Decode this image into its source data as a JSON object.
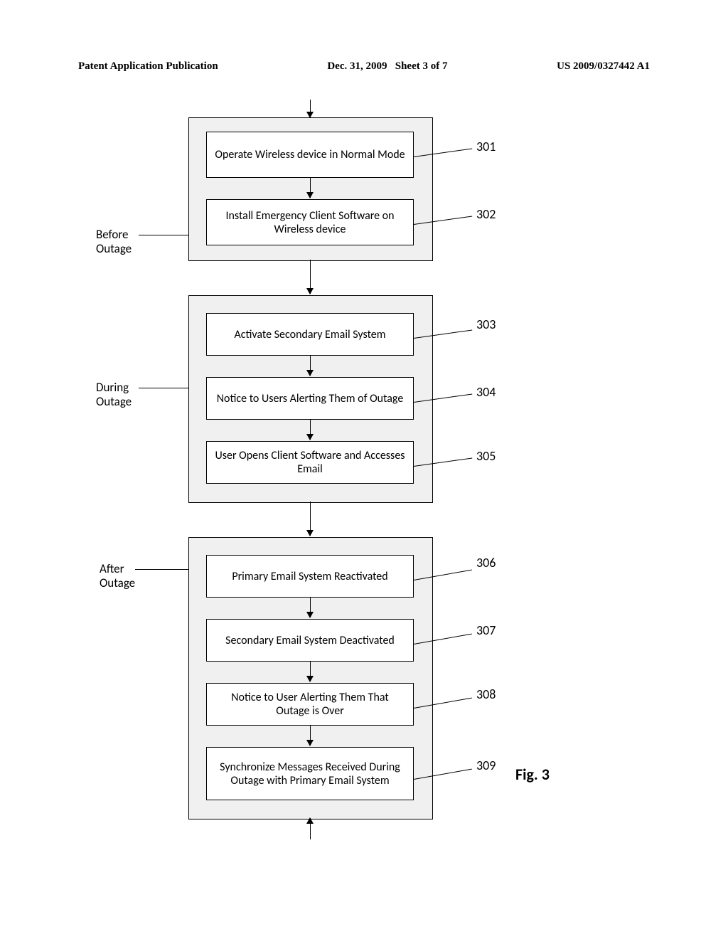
{
  "header": {
    "left": "Patent Application Publication",
    "date": "Dec. 31, 2009",
    "sheet": "Sheet 3 of 7",
    "pubno": "US 2009/0327442 A1"
  },
  "phases": {
    "before": "Before\nOutage",
    "during": "During\nOutage",
    "after": "After\nOutage"
  },
  "steps": {
    "s301": {
      "num": "301",
      "text": "Operate Wireless device in Normal Mode"
    },
    "s302": {
      "num": "302",
      "text": "Install Emergency Client Software on Wireless device"
    },
    "s303": {
      "num": "303",
      "text": "Activate Secondary Email System"
    },
    "s304": {
      "num": "304",
      "text": "Notice to Users Alerting Them of Outage"
    },
    "s305": {
      "num": "305",
      "text": "User Opens Client Software and Accesses Email"
    },
    "s306": {
      "num": "306",
      "text": "Primary Email System Reactivated"
    },
    "s307": {
      "num": "307",
      "text": "Secondary Email System Deactivated"
    },
    "s308": {
      "num": "308",
      "text": "Notice to User Alerting Them That Outage is Over"
    },
    "s309": {
      "num": "309",
      "text": "Synchronize Messages Received During Outage with Primary Email System"
    }
  },
  "figure": "Fig. 3"
}
